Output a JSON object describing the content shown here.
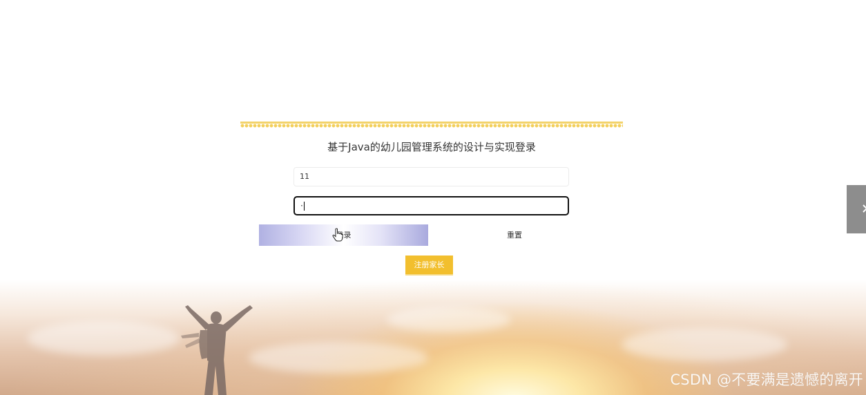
{
  "login": {
    "title": "基于Java的幼儿园管理系统的设计与实现登录",
    "username_value": "11",
    "password_value": "·",
    "login_label": "登录",
    "reset_label": "重置",
    "register_label": "注册家长"
  },
  "watermark": {
    "text": "CSDN @不要满是遗憾的离开"
  },
  "colors": {
    "register_button": "#f2bf2e",
    "lace": "#f3cf5a",
    "side_tab": "#8d8d8d"
  },
  "icons": {
    "cursor": "hand-pointer-icon",
    "side_tab": "chevron-icon"
  }
}
